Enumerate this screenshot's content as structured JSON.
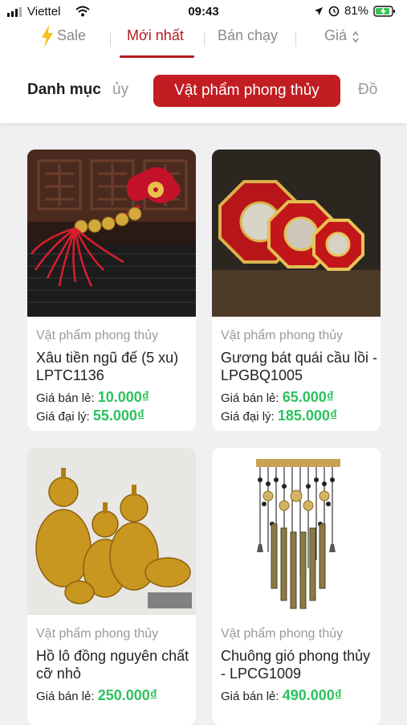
{
  "status": {
    "carrier": "Viettel",
    "time": "09:43",
    "battery": "81%"
  },
  "sort_tabs": [
    {
      "label": "Sale",
      "active": false
    },
    {
      "label": "Mới nhất",
      "active": true
    },
    {
      "label": "Bán chạy",
      "active": false
    },
    {
      "label": "Giá",
      "active": false
    }
  ],
  "categories": {
    "title": "Danh mục",
    "prev_partial": "ủy",
    "active": "Vật phẩm phong thủy",
    "next_partial": "Đồ"
  },
  "products": [
    {
      "category": "Vật phẩm phong thủy",
      "name": "Xâu tiền ngũ đế (5 xu) LPTC1136",
      "retail_label": "Giá bán lẻ:",
      "retail_price": "10.000₫",
      "dealer_label": "Giá đại lý:",
      "dealer_price": "55.000₫"
    },
    {
      "category": "Vật phẩm phong thủy",
      "name": "Gương bát quái cầu lồi - LPGBQ1005",
      "retail_label": "Giá bán lẻ:",
      "retail_price": "65.000₫",
      "dealer_label": "Giá đại lý:",
      "dealer_price": "185.000₫"
    },
    {
      "category": "Vật phẩm phong thủy",
      "name": "Hồ lô đồng nguyên chất cỡ nhỏ",
      "retail_label": "Giá bán lẻ:",
      "retail_price": "250.000₫"
    },
    {
      "category": "Vật phẩm phong thủy",
      "name": "Chuông gió phong thủy - LPCG1009",
      "retail_label": "Giá bán lẻ:",
      "retail_price": "490.000₫"
    }
  ],
  "colors": {
    "accent": "#c11d22",
    "price": "#2cc25d",
    "muted": "#9a9a9a"
  },
  "icons": [
    "signal-icon",
    "wifi-icon",
    "location-icon",
    "alarm-icon",
    "battery-icon",
    "lightning-icon",
    "sort-arrows-icon"
  ]
}
